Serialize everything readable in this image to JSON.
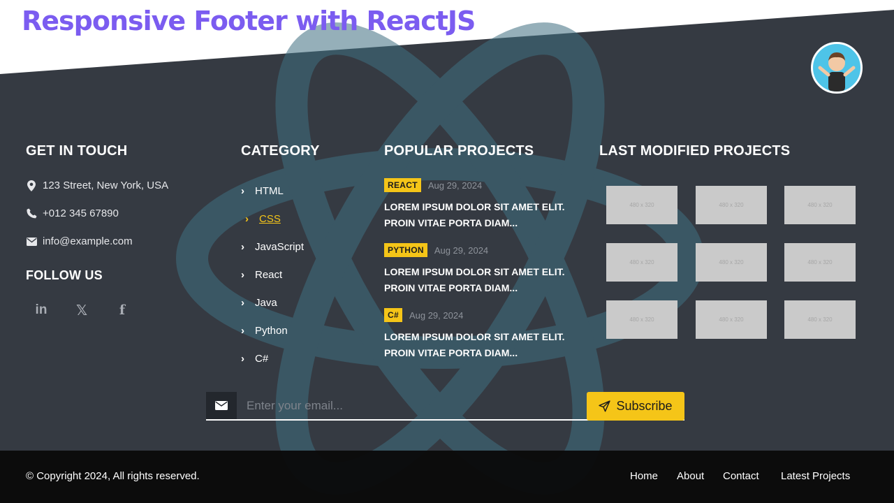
{
  "banner": {
    "title": "Responsive Footer with ReactJS"
  },
  "colors": {
    "accent": "#f5c518",
    "banner": "#7b5cf0",
    "footer_bg": "#353a42",
    "bottom_bar": "#0a0a0a"
  },
  "contact": {
    "heading": "GET IN TOUCH",
    "address": "123 Street, New York, USA",
    "phone": "+012 345 67890",
    "email": "info@example.com",
    "icons": [
      "map-marker-icon",
      "phone-icon",
      "envelope-icon"
    ]
  },
  "follow": {
    "heading": "FOLLOW US",
    "icons": [
      "linkedin-icon",
      "x-twitter-icon",
      "facebook-icon"
    ],
    "linkedin": "in",
    "x": "𝕏",
    "facebook": "f"
  },
  "category": {
    "heading": "CATEGORY",
    "items": [
      {
        "label": "HTML"
      },
      {
        "label": "CSS"
      },
      {
        "label": "JavaScript"
      },
      {
        "label": "React"
      },
      {
        "label": "Java"
      },
      {
        "label": "Python"
      },
      {
        "label": "C#"
      }
    ]
  },
  "popular": {
    "heading": "POPULAR PROJECTS",
    "items": [
      {
        "tag": "REACT",
        "date": "Aug 29, 2024",
        "title_line1": "LOREM IPSUM DOLOR SIT AMET ELIT.",
        "title_line2": "PROIN VITAE PORTA DIAM..."
      },
      {
        "tag": "PYTHON",
        "date": "Aug 29, 2024",
        "title_line1": "LOREM IPSUM DOLOR SIT AMET ELIT.",
        "title_line2": "PROIN VITAE PORTA DIAM..."
      },
      {
        "tag": "C#",
        "date": "Aug 29, 2024",
        "title_line1": "LOREM IPSUM DOLOR SIT AMET ELIT.",
        "title_line2": "PROIN VITAE PORTA DIAM..."
      }
    ]
  },
  "last_modified": {
    "heading": "LAST MODIFIED PROJECTS",
    "thumb_label": "480 x 320"
  },
  "newsletter": {
    "placeholder": "Enter your email...",
    "button_label": "Subscribe"
  },
  "bottom": {
    "copyright": "© Copyright 2024, All rights reserved.",
    "links": [
      {
        "label": "Home"
      },
      {
        "label": "About"
      },
      {
        "label": "Contact"
      },
      {
        "label": "Latest Projects"
      }
    ]
  }
}
